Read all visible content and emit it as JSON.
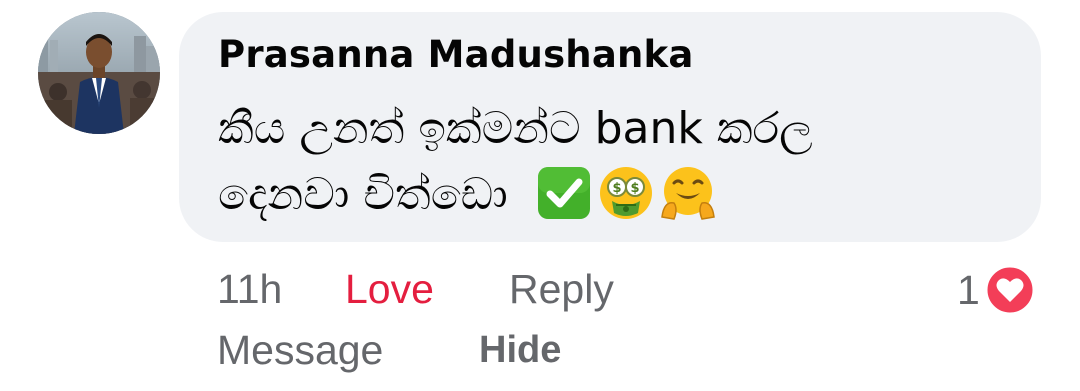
{
  "comment": {
    "author": "Prasanna Madushanka",
    "text_line1": "කීය උනත් ඉක්මන්ට bank කරල",
    "text_line2": "දෙනවා චිත්ඩො",
    "emojis": [
      "check-mark-button-emoji",
      "money-mouth-face-emoji",
      "hugging-face-emoji"
    ],
    "avatar_icon": "avatar-photo"
  },
  "actions": {
    "time": "11h",
    "love": "Love",
    "reply": "Reply",
    "message": "Message",
    "hide": "Hide"
  },
  "reactions": {
    "count": "1",
    "icon": "heart-icon"
  },
  "colors": {
    "bubble": "#f0f2f5",
    "love": "#e41e3f",
    "meta": "#65676b",
    "heart": "#f33e58"
  }
}
